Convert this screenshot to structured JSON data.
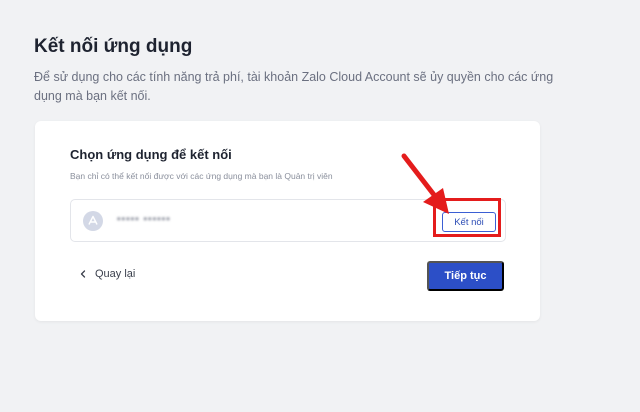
{
  "page": {
    "title": "Kết nối ứng dụng",
    "description": "Để sử dụng cho các tính năng trả phí, tài khoản Zalo Cloud Account sẽ ủy quyền cho các ứng dụng mà bạn kết nối."
  },
  "card": {
    "title": "Chọn ứng dụng để kết nối",
    "subtitle": "Bạn chỉ có thể kết nối được với các ứng dụng mà bạn là Quản trị viên",
    "app": {
      "icon": "app-store-icon",
      "name": "▪▪▪▪▪ ▪▪▪▪▪▪",
      "connect_label": "Kết nối"
    },
    "back_label": "Quay lại",
    "continue_label": "Tiếp tục"
  },
  "colors": {
    "primary": "#2c4fc7",
    "annotation": "#e41c1c",
    "background": "#f1f2f4"
  }
}
